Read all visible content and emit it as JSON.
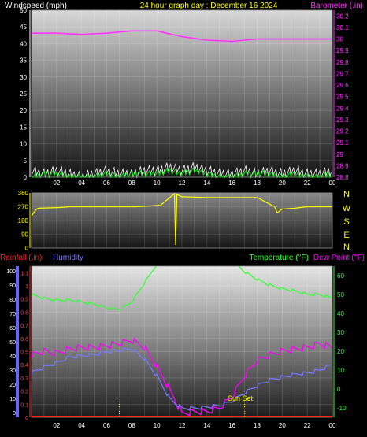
{
  "title": "24 hour graph day : December 16 2024",
  "colors": {
    "wind": "#ffffff",
    "gust": "#00ff00",
    "barometer": "#ff33ff",
    "direction": "#ffff00",
    "humidity": "#7777ff",
    "temperature": "#33ff33",
    "dewpoint": "#ff00ff",
    "rainfall": "#ff2222",
    "axis_blue": "#6666ff",
    "title": "#ffff00",
    "compass": "#ffff00"
  },
  "x_tick_labels": [
    "02",
    "04",
    "06",
    "08",
    "10",
    "12",
    "14",
    "16",
    "18",
    "20",
    "22",
    "00"
  ],
  "chart_data": [
    {
      "type": "line",
      "ylabel": "Windspeed (mph)",
      "y2label": "Barometer (.in)",
      "ylim": [
        0,
        50
      ],
      "y2lim": [
        28.8,
        30.25
      ],
      "y_ticks": [
        "0",
        "5",
        "10",
        "15",
        "20",
        "25",
        "30",
        "35",
        "40",
        "45",
        "50"
      ],
      "y2_ticks": [
        "28.8",
        "28.9",
        "29",
        "29.1",
        "29.2",
        "29.3",
        "29.4",
        "29.5",
        "29.6",
        "29.7",
        "29.8",
        "29.9",
        "30",
        "30.1",
        "30.2"
      ],
      "grid": true,
      "series": [
        {
          "name": "Barometer (.in)",
          "axis": "right",
          "x": [
            0,
            2,
            4,
            6,
            8,
            10,
            12,
            14,
            16,
            18,
            20,
            22,
            24
          ],
          "values": [
            30.05,
            30.05,
            30.04,
            30.05,
            30.07,
            30.07,
            30.02,
            29.99,
            29.98,
            30.0,
            30.0,
            30.0,
            30.0
          ]
        },
        {
          "name": "Windspeed",
          "axis": "left",
          "x": [
            0,
            1,
            2,
            3,
            4,
            5,
            6,
            7,
            8,
            9,
            10,
            11,
            12,
            13,
            14,
            15,
            16,
            17,
            18,
            19,
            20,
            21,
            22,
            23,
            24
          ],
          "values": [
            2,
            1,
            2,
            1,
            0,
            1,
            2,
            1,
            1,
            2,
            2,
            3,
            2,
            3,
            2,
            1,
            1,
            2,
            1,
            2,
            1,
            2,
            1,
            1,
            2
          ]
        },
        {
          "name": "Gust",
          "axis": "left",
          "x": [
            0,
            1,
            2,
            3,
            4,
            5,
            6,
            7,
            8,
            9,
            10,
            11,
            12,
            13,
            14,
            15,
            16,
            17,
            18,
            19,
            20,
            21,
            22,
            23,
            24
          ],
          "values": [
            0,
            1,
            1,
            0,
            0,
            0,
            1,
            0,
            1,
            1,
            1,
            2,
            1,
            2,
            1,
            0,
            0,
            1,
            1,
            1,
            0,
            1,
            0,
            0,
            1
          ]
        }
      ]
    },
    {
      "type": "line",
      "ylabel": "",
      "ylim": [
        0,
        360
      ],
      "y_ticks": [
        "0",
        "90",
        "180",
        "270",
        "360"
      ],
      "compass": [
        "N",
        "W",
        "S",
        "E",
        "N"
      ],
      "grid": true,
      "series": [
        {
          "name": "Wind direction",
          "x": [
            0,
            0.4,
            0.6,
            2.3,
            3,
            5,
            6,
            7.2,
            8.3,
            9.5,
            10.3,
            11.4,
            11.5,
            11.6,
            12,
            14,
            16,
            18,
            19.4,
            19.6,
            20,
            21,
            22,
            24
          ],
          "values": [
            210,
            255,
            260,
            265,
            270,
            270,
            270,
            270,
            270,
            275,
            280,
            355,
            20,
            350,
            335,
            330,
            330,
            330,
            270,
            230,
            255,
            260,
            270,
            270
          ]
        }
      ]
    },
    {
      "type": "line",
      "ylabel": "Rainfall (.in)",
      "y2label": "Temperature (°F)",
      "ylim": [
        0,
        1.15
      ],
      "y2lim": [
        -15,
        65
      ],
      "y_ticks": [
        "0",
        "0.1",
        "0.2",
        "0.3",
        "0.4",
        "0.5",
        "0.6",
        "0.7",
        "0.8",
        "0.9",
        "1",
        "1.1"
      ],
      "y2_ticks": [
        "-10",
        "0",
        "10",
        "20",
        "30",
        "40",
        "50",
        "60"
      ],
      "humidity_ticks": [
        "0",
        "10",
        "20",
        "30",
        "40",
        "50",
        "60",
        "70",
        "80",
        "90",
        "100"
      ],
      "grid": true,
      "annotations": [
        "Sun Set"
      ],
      "series": [
        {
          "name": "Temperature (°F)",
          "axis": "right",
          "x": [
            0,
            1,
            2,
            3,
            4,
            5,
            6,
            7,
            8,
            9,
            10,
            11,
            12,
            13,
            14,
            15,
            16,
            17,
            18,
            19,
            20,
            21,
            22,
            23,
            24
          ],
          "values": [
            50,
            48,
            47,
            47,
            46,
            45,
            43,
            42,
            46,
            56,
            66,
            72,
            74,
            74,
            73,
            72,
            68,
            62,
            58,
            55,
            53,
            52,
            50,
            50,
            48
          ]
        },
        {
          "name": "Dew Point (°F)",
          "axis": "right",
          "x": [
            0,
            1,
            2,
            3,
            4,
            5,
            6,
            7,
            8,
            9,
            10,
            11,
            12,
            13,
            14,
            15,
            16,
            17,
            18,
            19,
            20,
            21,
            22,
            23,
            24
          ],
          "values": [
            18,
            20,
            19,
            21,
            22,
            22,
            23,
            24,
            26,
            22,
            12,
            0,
            -13,
            -12,
            -12,
            -10,
            -4,
            7,
            15,
            18,
            20,
            21,
            22,
            24,
            22
          ]
        },
        {
          "name": "Humidity",
          "axis": "humidity",
          "x": [
            0,
            1,
            2,
            3,
            4,
            5,
            6,
            7,
            8,
            9,
            10,
            11,
            12,
            13,
            14,
            15,
            16,
            17,
            18,
            19,
            20,
            21,
            22,
            23,
            24
          ],
          "values": [
            28,
            32,
            35,
            39,
            40,
            41,
            43,
            44,
            45,
            38,
            26,
            10,
            3,
            3,
            4,
            5,
            8,
            14,
            19,
            23,
            25,
            27,
            28,
            30,
            34
          ]
        },
        {
          "name": "Rainfall (.in)",
          "axis": "left",
          "x": [
            0,
            24
          ],
          "values": [
            0,
            0
          ]
        }
      ]
    }
  ]
}
